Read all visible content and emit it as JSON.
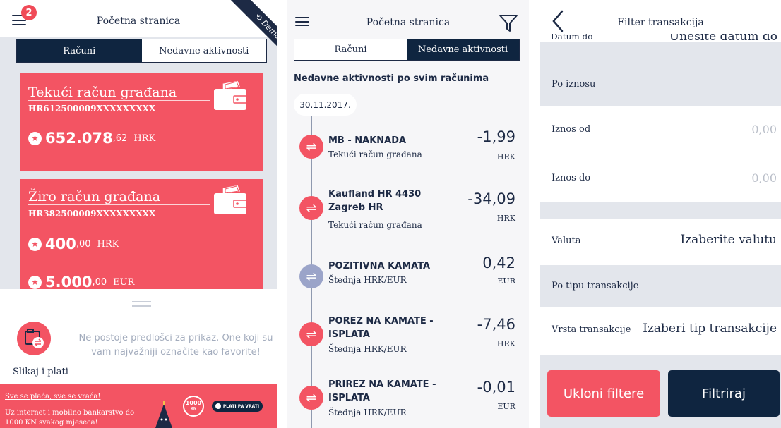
{
  "screen1": {
    "header_title": "Početna stranica",
    "badge_count": "2",
    "demo_ribbon": "Demo",
    "tabs": [
      "Računi",
      "Nedavne aktivnosti"
    ],
    "cards": [
      {
        "name": "Tekući račun građana",
        "iban": "HR612500009XXXXXXXXX",
        "balances": [
          {
            "int": "652.078",
            "dec": ",62",
            "cur": "HRK"
          }
        ]
      },
      {
        "name": "Žiro račun građana",
        "iban": "HR382500009XXXXXXXXX",
        "balances": [
          {
            "int": "400",
            "dec": ",00",
            "cur": "HRK"
          },
          {
            "int": "5.000",
            "dec": ",00",
            "cur": "EUR"
          }
        ]
      }
    ],
    "snap_label": "Slikaj i plati",
    "favorites_text": "Ne postoje predlošci za prikaz. One koji su vam najvažniji označite kao favorite!",
    "banner": {
      "line1": "Sve se plaća, sve se vraća!",
      "line2": "Uz internet i mobilno bankarstvo do 1000 KN svakog mjeseca!",
      "ring_value": "1000",
      "ring_unit": "KN",
      "pay_button": "PLATI PA VRATI"
    }
  },
  "screen2": {
    "header_title": "Početna stranica",
    "tabs": [
      "Računi",
      "Nedavne aktivnosti"
    ],
    "section_title": "Nedavne aktivnosti po svim računima",
    "date": "30.11.2017.",
    "transactions": [
      {
        "name": "MB - NAKNADA",
        "account": "Tekući račun građana",
        "amount": "-1,99",
        "currency": "HRK",
        "kind": "red"
      },
      {
        "name": "Kaufland HR 4430 Zagreb      HR",
        "account": "Tekući račun građana",
        "amount": "-34,09",
        "currency": "HRK",
        "kind": "red"
      },
      {
        "name": "POZITIVNA KAMATA",
        "account": "Štednja HRK/EUR",
        "amount": "0,42",
        "currency": "EUR",
        "kind": "blue"
      },
      {
        "name": "POREZ NA KAMATE - ISPLATA",
        "account": "Štednja HRK/EUR",
        "amount": "-7,46",
        "currency": "HRK",
        "kind": "red"
      },
      {
        "name": "PRIREZ NA KAMATE - ISPLATA",
        "account": "Štednja HRK/EUR",
        "amount": "-0,01",
        "currency": "EUR",
        "kind": "red"
      }
    ]
  },
  "screen3": {
    "header_title": "Filter transakcija",
    "cut_label": "Datum do",
    "cut_value": "Unesite datum do",
    "amount_section": "Po iznosu",
    "amount_from_label": "Iznos od",
    "amount_from_value": "0,00",
    "amount_to_label": "Iznos do",
    "amount_to_value": "0,00",
    "currency_label": "Valuta",
    "currency_value": "Izaberite valutu",
    "type_section": "Po tipu transakcije",
    "type_label": "Vrsta transakcije",
    "type_value": "Izaberi tip transakcije",
    "clear_button": "Ukloni filtere",
    "apply_button": "Filtriraj"
  },
  "colors": {
    "navy": "#0f2540",
    "coral": "#f35463",
    "grey_bg": "#e3e6ec",
    "muted": "#a3acbd"
  },
  "icons": [
    "menu-icon",
    "wallet-icon",
    "star-icon",
    "camera-icon",
    "filter-icon",
    "transfer-icon",
    "back-chevron-icon"
  ]
}
